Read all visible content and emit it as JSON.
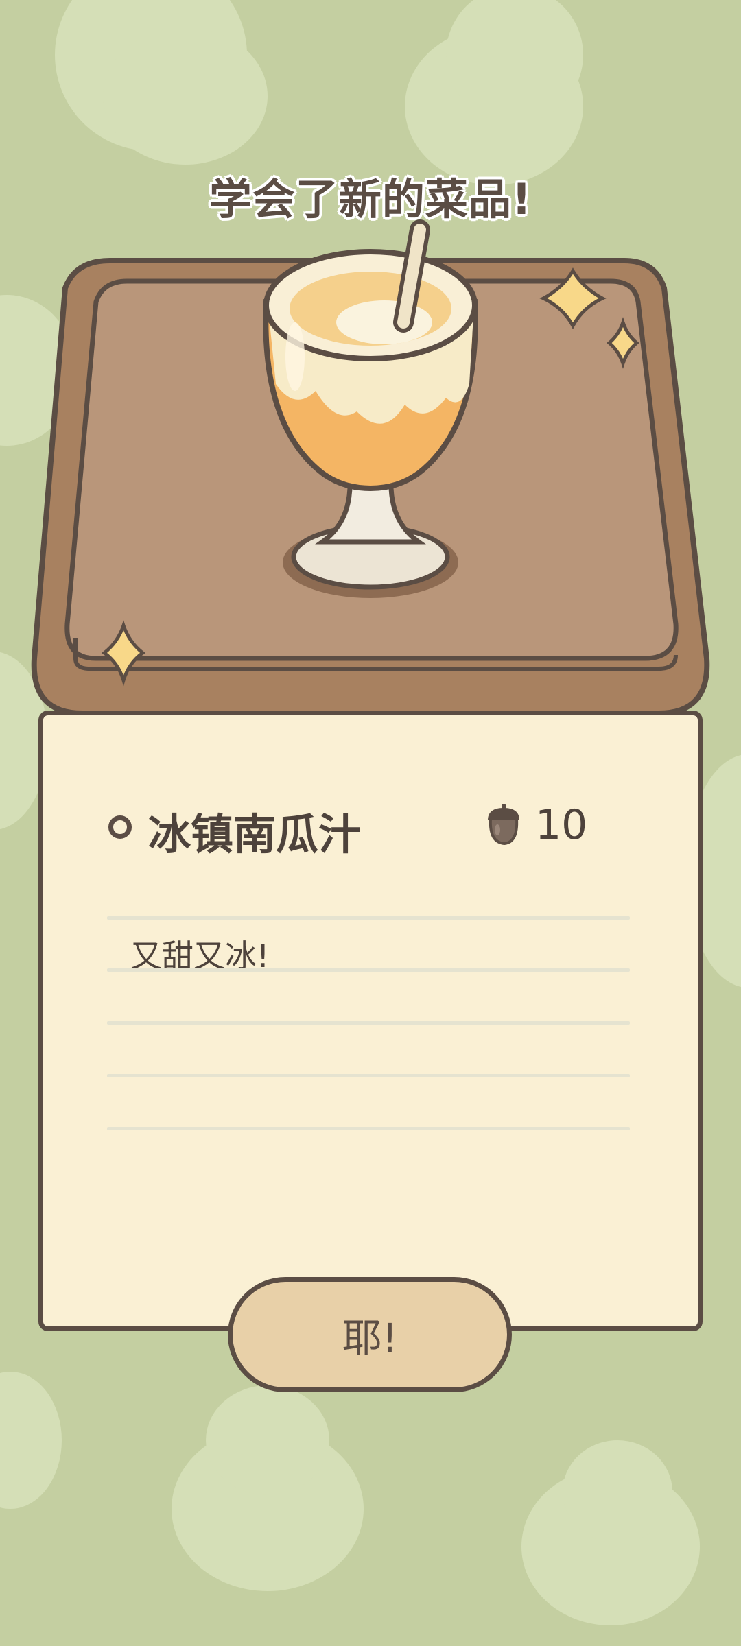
{
  "banner": {
    "text": "学会了新的菜品!"
  },
  "dish": {
    "name": "冰镇南瓜汁",
    "price": "10",
    "price_icon": "acorn-icon",
    "description": "又甜又冰!"
  },
  "confirm_button": {
    "label": "耶!"
  },
  "colors": {
    "background": "#c4cfa1",
    "background_blob": "#d5dfb7",
    "tray": "#a88160",
    "card": "#faf0d4",
    "outline": "#5b4d44",
    "button": "#e8d0a8",
    "sparkle": "#f8d889"
  }
}
